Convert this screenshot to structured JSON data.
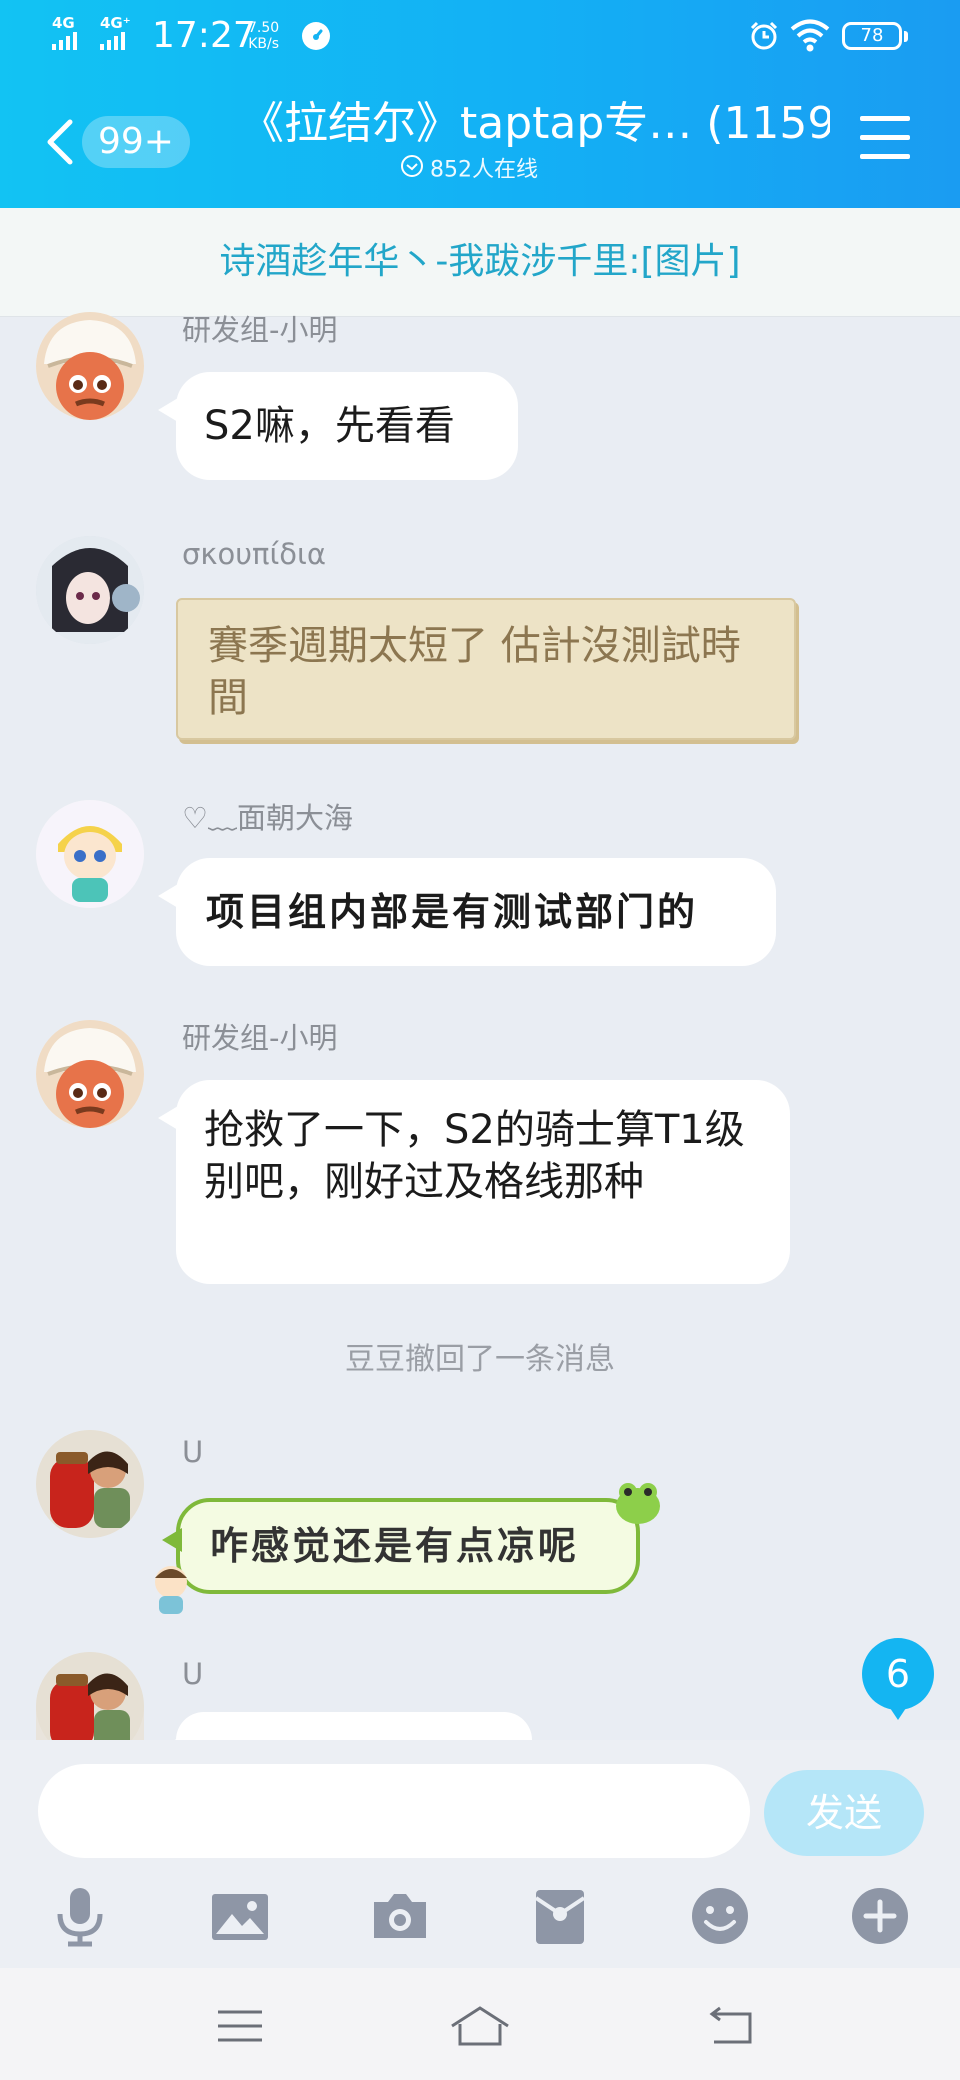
{
  "status_bar": {
    "network_1": "4G",
    "network_2": "4G⁺",
    "time": "17:27",
    "speed_value": "7.50",
    "speed_unit": "KB/s",
    "battery": "78"
  },
  "header": {
    "back_badge": "99+",
    "title": "《拉结尔》taptap专… (1159)",
    "online": "852人在线"
  },
  "notice": {
    "text": "诗酒趁年华丶-我跋涉千里:[图片]"
  },
  "messages": [
    {
      "sender": "研发组-小明",
      "text": "S2嘛，先看看"
    },
    {
      "sender": "σκουπίδια",
      "text": "賽季週期太短了 估計沒測試時間"
    },
    {
      "sender": "♡﹏面朝大海",
      "text": "项目组内部是有测试部门的"
    },
    {
      "sender": "研发组-小明",
      "text": "抢救了一下，S2的骑士算T1级别吧，刚好过及格线那种"
    },
    {
      "sender": "U",
      "text": "咋感觉还是有点凉呢"
    },
    {
      "sender": "U",
      "text": ""
    }
  ],
  "system_message": "豆豆撤回了一条消息",
  "new_message_count": "6",
  "input": {
    "value": "",
    "send_label": "发送"
  },
  "toolbar_icons": [
    "microphone-icon",
    "image-icon",
    "camera-icon",
    "red-packet-icon",
    "emoji-icon",
    "plus-icon"
  ],
  "colors": {
    "header_start": "#12c3f3",
    "header_end": "#1a9cf2",
    "notice_text": "#22a6c9",
    "send_disabled": "#b5e6f8",
    "badge": "#14b5f2"
  }
}
